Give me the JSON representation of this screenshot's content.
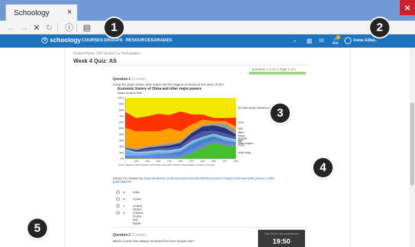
{
  "browser": {
    "tab_title": "Schoology",
    "tab_close": "×",
    "window_close": "×",
    "toolbar": {
      "back": "←",
      "forward": "→",
      "stop": "✕",
      "refresh": "↻",
      "info": "ⓘ",
      "reader": "▤"
    }
  },
  "nav": {
    "logo": "schoology",
    "links": [
      "COURSES",
      "GROUPS",
      "RESOURCES",
      "GRADES"
    ],
    "icons": [
      "search-icon",
      "calendar-icon",
      "mail-icon",
      "bell-icon"
    ],
    "user_name": "Irene Adler",
    "caret": "⌄"
  },
  "page": {
    "breadcrumb": "Global History 10B Section 1 ▸ Participation",
    "title": "Week 4 Quiz: AS",
    "question_count": "Questions 1-4 of 4 | Page 1 of 1",
    "progress": 1.0
  },
  "question1": {
    "heading": "Question 1",
    "points": "(5 points)",
    "text": "Using the graph below, what nation had the biggest economy at the dawn of AD?",
    "source_label": "Source:The Atlantic",
    "source_link": "http://www.theatlantic.com/business/archive/2012/06/the-economic-history-of-the-last-2000-years-in-1-little-graph/258676/",
    "answers": [
      {
        "letter": "a.",
        "text": "India"
      },
      {
        "letter": "b.",
        "text": "China"
      },
      {
        "letter": "c.",
        "text": "United States"
      },
      {
        "letter": "d.",
        "text": "Greece, Rome, and Egypt"
      }
    ]
  },
  "question2": {
    "heading": "Question 2",
    "points": "(5 points)",
    "text": "Which country has always remained free from foreign rule?"
  },
  "timer": {
    "label": "Time left for this assessment",
    "value": "19:50"
  },
  "callouts": [
    "1",
    "2",
    "3",
    "4",
    "5"
  ],
  "colors": {
    "nav": "#1e73be",
    "tab_strip": "#6f9ad6",
    "close": "#d01f2f",
    "progress": "#9ed27e",
    "callout": "#252525"
  },
  "chart_data": {
    "type": "area",
    "title": "Economic history of China and other major powers",
    "subtitle": "Share of world GDP",
    "x": [
      1,
      1000,
      1500,
      1600,
      1700,
      1820,
      1870,
      1913,
      1950,
      1973,
      2003
    ],
    "x_tick_labels": [
      "1",
      "1000",
      "1500",
      "1600",
      "1700",
      "1820",
      "1870",
      "1913",
      "1950",
      "1973",
      "2003"
    ],
    "ylim": [
      0,
      100
    ],
    "y_ticks": [
      "0%",
      "10%",
      "20%",
      "30%",
      "40%",
      "50%",
      "60%",
      "70%",
      "80%",
      "90%",
      "100%"
    ],
    "series": [
      {
        "name": "United States",
        "color": "#44bf2f",
        "values": [
          1,
          1,
          1,
          1,
          1,
          2,
          9,
          19,
          27,
          22,
          21
        ]
      },
      {
        "name": "France",
        "color": "#6f7ee0",
        "values": [
          3,
          3,
          4,
          5,
          5,
          5,
          6,
          5,
          4,
          4,
          3
        ]
      },
      {
        "name": "United Kingdom",
        "color": "#3c86c7",
        "values": [
          1,
          1,
          1,
          2,
          3,
          5,
          9,
          8,
          6,
          4,
          3
        ]
      },
      {
        "name": "Italy",
        "color": "#75aee0",
        "values": [
          9,
          4,
          4,
          4,
          3,
          3,
          3,
          3,
          3,
          4,
          3
        ]
      },
      {
        "name": "Spain",
        "color": "#9bc5ea",
        "values": [
          2,
          2,
          2,
          2,
          2,
          2,
          2,
          1,
          1,
          2,
          2
        ]
      },
      {
        "name": "Germany",
        "color": "#4f58a6",
        "values": [
          1,
          1,
          3,
          3,
          4,
          4,
          6,
          9,
          5,
          6,
          4
        ]
      },
      {
        "name": "Russia",
        "color": "#28357d",
        "values": [
          1,
          2,
          3,
          3,
          4,
          5,
          7,
          8,
          9,
          9,
          4
        ]
      },
      {
        "name": "Japan",
        "color": "#9a9a9a",
        "values": [
          1,
          3,
          3,
          3,
          4,
          3,
          2,
          3,
          3,
          8,
          7
        ]
      },
      {
        "name": "India",
        "color": "#ff9f00",
        "values": [
          32,
          28,
          24,
          22,
          24,
          16,
          12,
          8,
          4,
          3,
          6
        ]
      },
      {
        "name": "China",
        "color": "#ff3300",
        "values": [
          26,
          22,
          25,
          29,
          22,
          33,
          17,
          9,
          5,
          5,
          15
        ]
      },
      {
        "name": "Non-Asian ancient civilizations (Gre, Egy, Tur, Irn)",
        "color": "#f3e700",
        "values": [
          23,
          33,
          30,
          26,
          28,
          22,
          27,
          27,
          33,
          33,
          32
        ]
      }
    ],
    "legend": [
      "Non-Asian ancient civilizations (Gre, Egy, Tur, Irn)",
      "China",
      "India",
      "Japan",
      "Russia",
      "Germany",
      "Spain",
      "Italy",
      "United Kingdom",
      "France",
      "United States"
    ],
    "legend_placement": "right",
    "source_note": "Source: \"Statistics on World Population, GDP and Per Capita GDP, 1-2008 AD\", Angus Maddison, University of Groningen"
  }
}
